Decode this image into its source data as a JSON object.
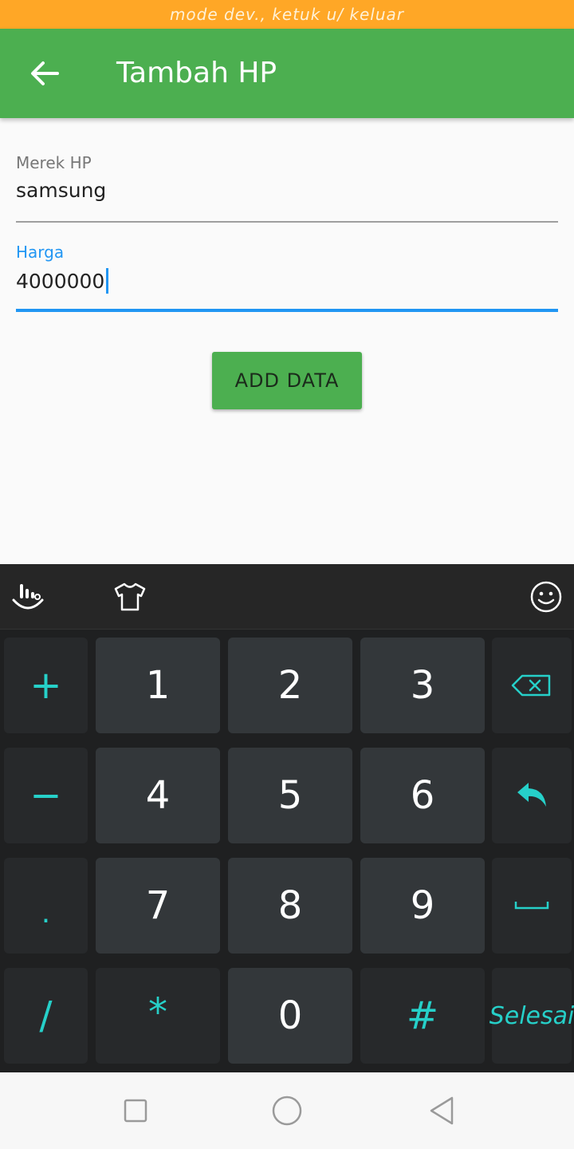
{
  "status_bar": {
    "text": "mode dev., ketuk u/ keluar"
  },
  "app_bar": {
    "title": "Tambah HP",
    "back_icon": "arrow-back-icon"
  },
  "form": {
    "brand": {
      "label": "Merek HP",
      "value": "samsung"
    },
    "price": {
      "label": "Harga",
      "value": "4000000"
    },
    "submit_label": "ADD DATA"
  },
  "keyboard": {
    "toolbar_icons": [
      "keyboard-logo-icon",
      "theme-shirt-icon",
      "emoji-icon"
    ],
    "keys": {
      "plus": "+",
      "one": "1",
      "two": "2",
      "three": "3",
      "minus": "−",
      "four": "4",
      "five": "5",
      "six": "6",
      "dot": ".",
      "seven": "7",
      "eight": "8",
      "nine": "9",
      "slash": "/",
      "star": "*",
      "zero": "0",
      "hash": "#",
      "done": "Selesai"
    },
    "accent_color": "#26d0c9"
  },
  "nav_bar": {
    "icons": [
      "recents-icon",
      "home-icon",
      "back-icon"
    ]
  },
  "colors": {
    "primary": "#4caf50",
    "status": "#ffa726",
    "focus": "#2196f3"
  }
}
